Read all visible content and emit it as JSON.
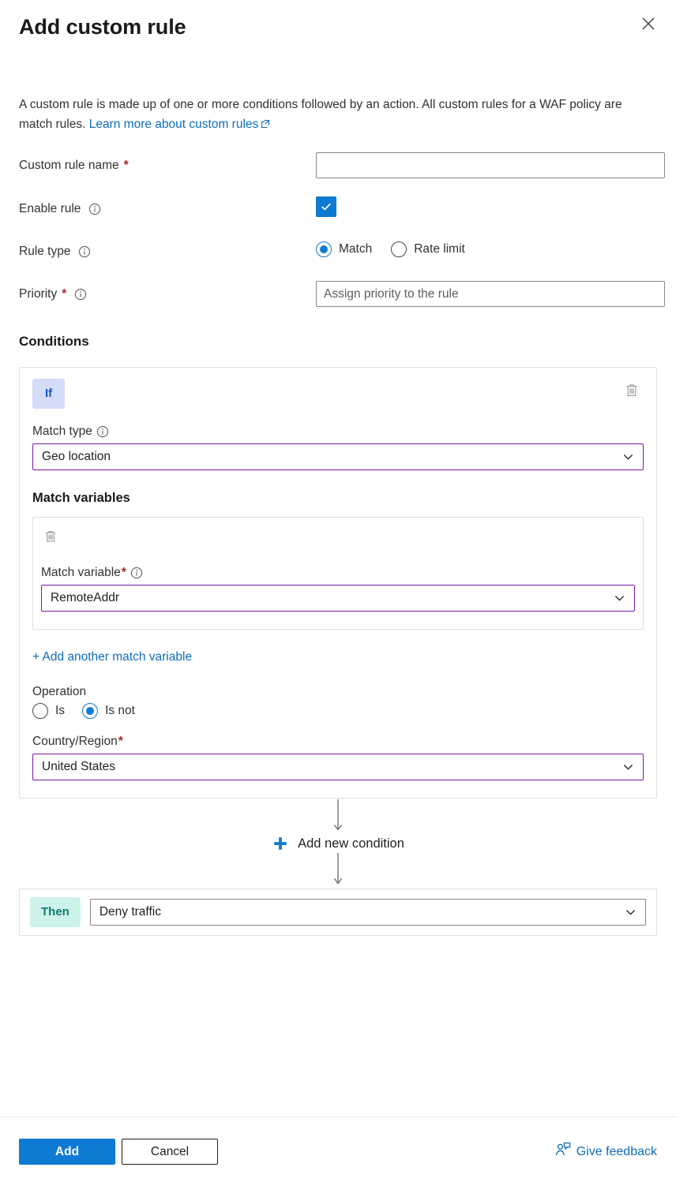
{
  "panel": {
    "title": "Add custom rule",
    "close_icon": "close-icon",
    "intro_part1": "A custom rule is made up of one or more conditions followed by an action. All custom rules for a WAF policy are match rules.",
    "intro_link": "Learn more about custom rules"
  },
  "form": {
    "custom_rule_name": {
      "label": "Custom rule name",
      "required": "*",
      "value": "",
      "placeholder": ""
    },
    "enable_rule": {
      "label": "Enable rule",
      "checked": true
    },
    "rule_type": {
      "label": "Rule type",
      "options": [
        "Match",
        "Rate limit"
      ],
      "selected": "Match"
    },
    "priority": {
      "label": "Priority",
      "required": "*",
      "value": "",
      "placeholder": "Assign priority to the rule"
    }
  },
  "conditions": {
    "heading": "Conditions",
    "if_badge": "If",
    "match_type": {
      "label": "Match type",
      "value": "Geo location"
    },
    "match_variables": {
      "heading": "Match variables",
      "items": [
        {
          "label": "Match variable",
          "required": "*",
          "value": "RemoteAddr"
        }
      ],
      "add_link": "+ Add another match variable"
    },
    "operation": {
      "label": "Operation",
      "options": [
        "Is",
        "Is not"
      ],
      "selected": "Is not"
    },
    "country_region": {
      "label": "Country/Region",
      "required": "*",
      "value": "United States"
    },
    "add_condition": "Add new condition"
  },
  "action": {
    "then_badge": "Then",
    "value": "Deny traffic"
  },
  "footer": {
    "add_label": "Add",
    "cancel_label": "Cancel",
    "feedback_label": "Give feedback"
  },
  "colors": {
    "accent_blue": "#0f7ad1",
    "link_blue": "#0f6cbd",
    "required_red": "#a4262c",
    "dropdown_purple": "#7719aa",
    "if_badge_bg": "#d3ddf8",
    "if_badge_text": "#1f4fd0",
    "then_badge_bg": "#cdf2ea",
    "then_badge_text": "#0b7b72",
    "border_grey": "#e1dfdd"
  }
}
